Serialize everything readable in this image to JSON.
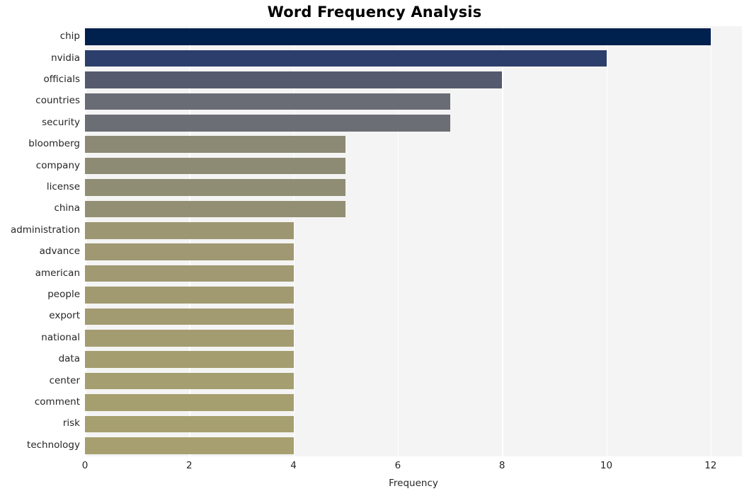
{
  "chart_data": {
    "type": "bar",
    "orientation": "horizontal",
    "title": "Word Frequency Analysis",
    "xlabel": "Frequency",
    "ylabel": "",
    "xlim": [
      0,
      12.6
    ],
    "ylim": [
      0,
      20
    ],
    "grid": true,
    "legend": null,
    "xticks": [
      "0",
      "2",
      "4",
      "6",
      "8",
      "10",
      "12"
    ],
    "xtick_values": [
      0,
      2,
      4,
      6,
      8,
      10,
      12
    ],
    "categories": [
      "chip",
      "nvidia",
      "officials",
      "countries",
      "security",
      "bloomberg",
      "company",
      "license",
      "china",
      "administration",
      "advance",
      "american",
      "people",
      "export",
      "national",
      "data",
      "center",
      "comment",
      "risk",
      "technology"
    ],
    "values": [
      12,
      10,
      8,
      7,
      7,
      5,
      5,
      5,
      5,
      4,
      4,
      4,
      4,
      4,
      4,
      4,
      4,
      4,
      4,
      4
    ],
    "colors": [
      "#00204d",
      "#2c3e6b",
      "#565a6e",
      "#696c75",
      "#6c6e76",
      "#8c8975",
      "#8e8b75",
      "#908d75",
      "#928f74",
      "#9d9672",
      "#9f9872",
      "#a09971",
      "#a19a71",
      "#a29b71",
      "#a39c70",
      "#a49d70",
      "#a59e70",
      "#a59e6f",
      "#a69f6f",
      "#a79f6f"
    ],
    "palette": "cividis",
    "style": {
      "plot_background": "#f4f4f4",
      "figure_background": "#ffffff",
      "gridline_color": "#ffffff",
      "tick_label_color": "#262626",
      "title_color": "#000000"
    }
  }
}
